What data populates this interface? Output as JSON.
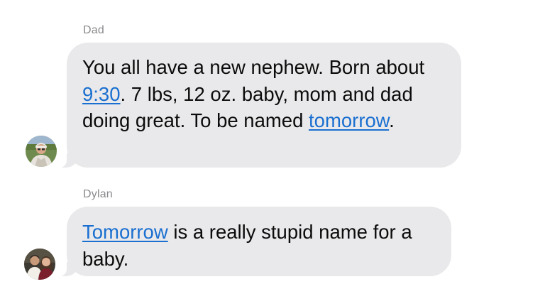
{
  "messages": [
    {
      "sender": "Dad",
      "parts": [
        {
          "text": "You all have a new nephew. Born about ",
          "link": false
        },
        {
          "text": "9:30",
          "link": true
        },
        {
          "text": ". 7 lbs, 12 oz. baby, mom and dad doing great. To be named ",
          "link": false
        },
        {
          "text": "tomorrow",
          "link": true
        },
        {
          "text": ".",
          "link": false
        }
      ]
    },
    {
      "sender": "Dylan",
      "parts": [
        {
          "text": "Tomorrow",
          "link": true
        },
        {
          "text": " is a really stupid name for a baby.",
          "link": false
        }
      ]
    }
  ],
  "colors": {
    "bubble": "#e9e9eb",
    "link": "#1a6fd0",
    "sender_name": "#8a8a8e"
  },
  "icons": {
    "dad_avatar": "avatar-photo-icon",
    "dylan_avatar": "avatar-photo-icon"
  }
}
